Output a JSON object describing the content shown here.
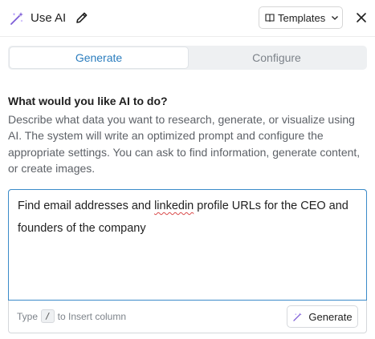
{
  "header": {
    "title": "Use AI",
    "title_icon": "magic-wand-icon",
    "edit_icon": "pencil-icon",
    "templates_label": "Templates",
    "templates_icon": "book-icon",
    "close_icon": "close-icon"
  },
  "tabs": [
    {
      "label": "Generate",
      "active": true
    },
    {
      "label": "Configure",
      "active": false
    }
  ],
  "main": {
    "question": "What would you like AI to do?",
    "description": "Describe what data you want to research, generate, or visualize using AI. The system will write an optimized prompt and configure the appropriate settings. You can ask to find information, generate content, or create images."
  },
  "prompt": {
    "text_before": "Find email addresses and ",
    "misspelled_word": "linkedin",
    "text_after": " profile URLs for the CEO and founders of the company",
    "hint_before": "Type",
    "hint_key": "/",
    "hint_after": "to Insert column",
    "generate_label": "Generate"
  },
  "colors": {
    "accent": "#2b7dbe",
    "focus_border": "#3b8bc9",
    "wand_purple": "#8b5cf6"
  }
}
